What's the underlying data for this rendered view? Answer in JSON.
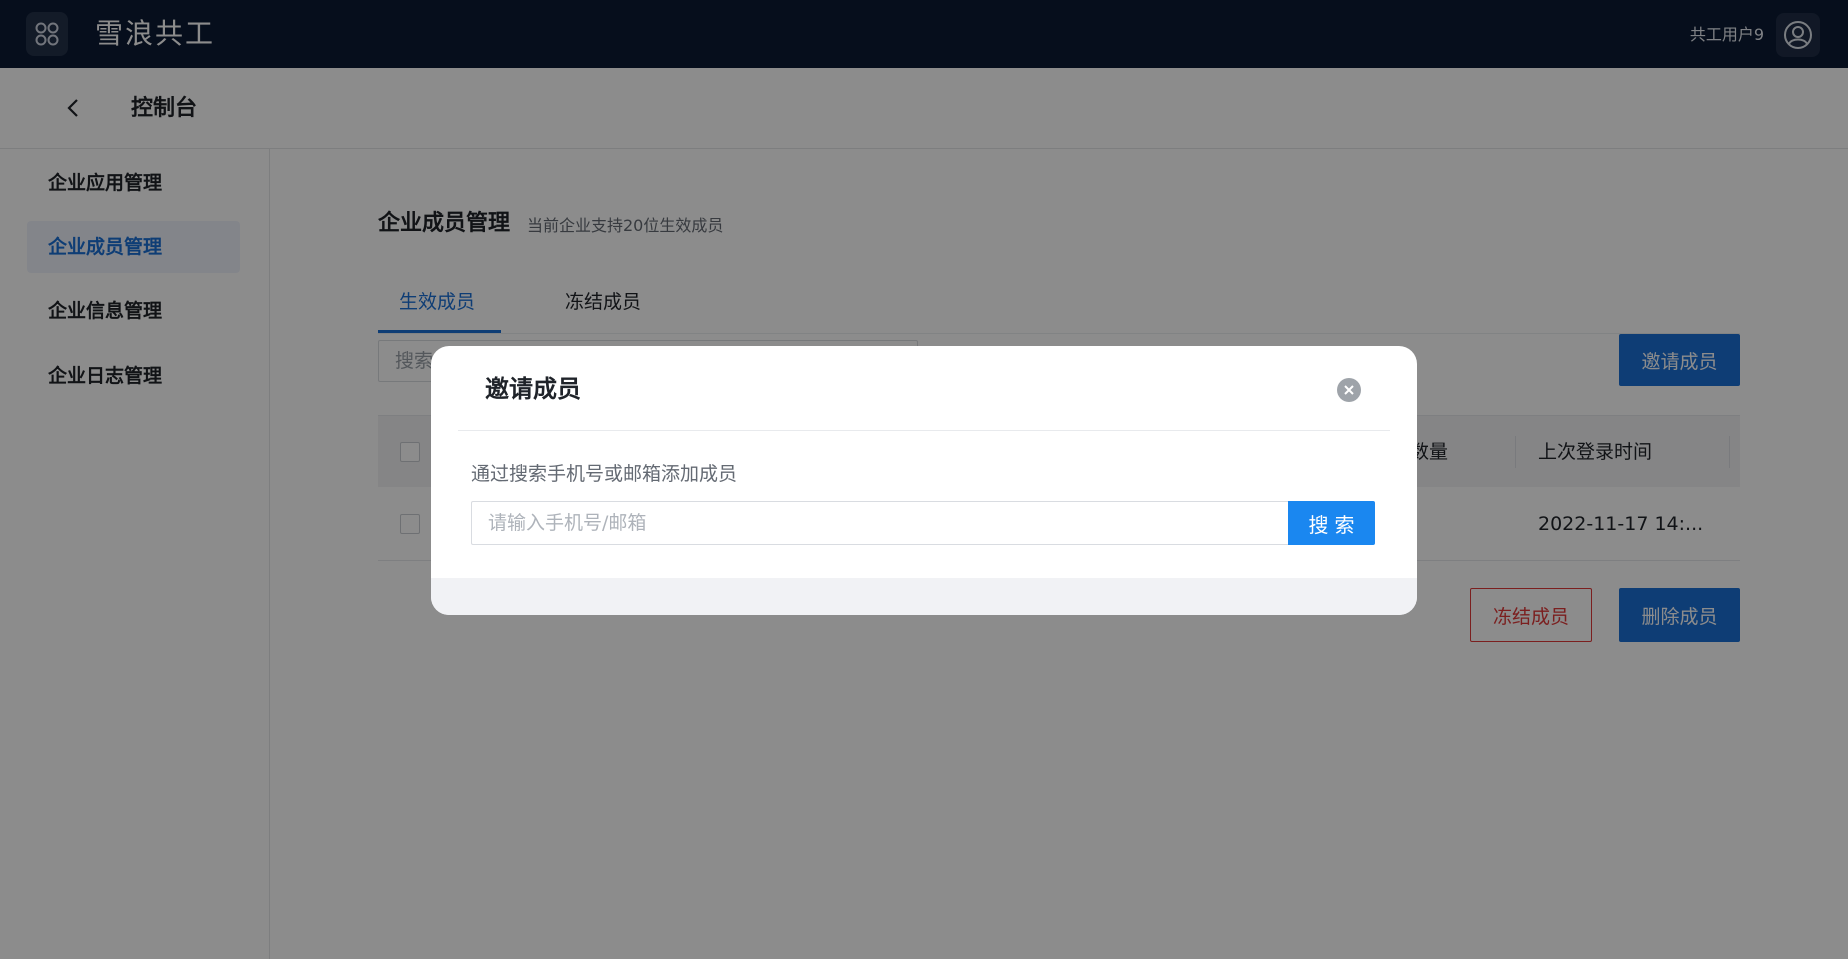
{
  "header": {
    "brand": "雪浪共工",
    "username": "共工用户9"
  },
  "subheader": {
    "title": "控制台"
  },
  "sidebar": {
    "items": [
      {
        "label": "企业应用管理",
        "active": false
      },
      {
        "label": "企业成员管理",
        "active": true
      },
      {
        "label": "企业信息管理",
        "active": false
      },
      {
        "label": "企业日志管理",
        "active": false
      }
    ]
  },
  "main": {
    "title": "企业成员管理",
    "subtitle": "当前企业支持20位生效成员",
    "tabs": [
      {
        "label": "生效成员",
        "active": true
      },
      {
        "label": "冻结成员",
        "active": false
      }
    ],
    "search_placeholder_visible": "搜索",
    "invite_button": "邀请成员",
    "table": {
      "headers": [
        "数量",
        "上次登录时间"
      ],
      "rows": [
        {
          "last_login": "2022-11-17 14:..."
        }
      ]
    },
    "freeze_button": "冻结成员",
    "delete_button": "删除成员"
  },
  "modal": {
    "title": "邀请成员",
    "hint": "通过搜索手机号或邮箱添加成员",
    "input_placeholder": "请输入手机号/邮箱",
    "input_value": "",
    "search_button": "搜索"
  },
  "colors": {
    "topbar": "#0b1a33",
    "accent": "#1a6fd6",
    "danger": "#e03a3a",
    "search_button": "#1a87f0"
  }
}
